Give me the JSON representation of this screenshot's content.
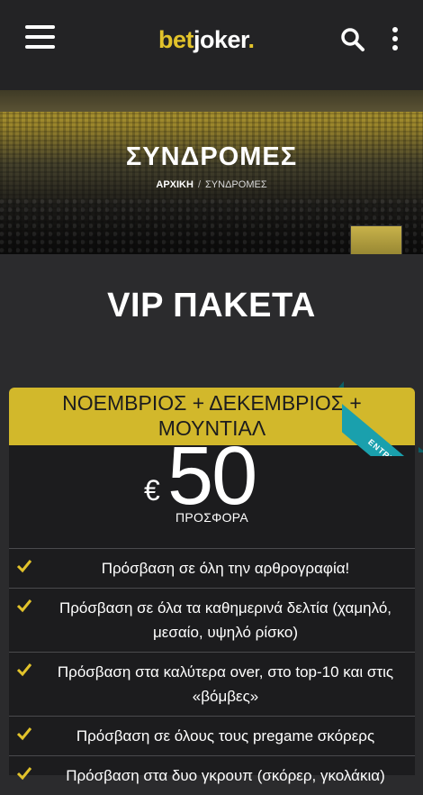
{
  "header": {
    "logo_prefix": "bet",
    "logo_suffix": "joker",
    "logo_dot": ".",
    "icons": {
      "menu": "hamburger-menu-icon",
      "search": "search-icon",
      "more": "kebab-menu-icon"
    }
  },
  "hero": {
    "title": "ΣΥΝΔΡΟΜΕΣ",
    "breadcrumb": {
      "home": "ΑΡΧΙΚΗ",
      "separator": "/",
      "current": "ΣΥΝΔΡΟΜΕΣ"
    }
  },
  "section_title": "VIP ΠΑΚΕΤΑ",
  "package": {
    "title": "ΝΟΕΜΒΡΙΟΣ + ΔΕΚΕΜΒΡΙΟΣ + ΜΟΥΝΤΙΑΛ",
    "ribbon": "ENTRY",
    "currency": "€",
    "price": "50",
    "price_label": "ΠΡΟΣΦΟΡΑ",
    "features": [
      "Πρόσβαση σε όλη την αρθρογραφία!",
      "Πρόσβαση σε όλα τα καθημερινά δελτία (χαμηλό, μεσαίο, υψηλό ρίσκο)",
      "Πρόσβαση στα καλύτερα over, στο top-10 και στις «βόμβες»",
      "Πρόσβαση σε όλους τους pregame σκόρερς",
      "Πρόσβαση στα δυο γκρουπ (σκόρερ, γκολάκια)"
    ]
  },
  "colors": {
    "accent": "#e2c32b",
    "card_header": "#d2b82b",
    "ribbon": "#1aa0ad",
    "background": "#2b2b2d"
  }
}
